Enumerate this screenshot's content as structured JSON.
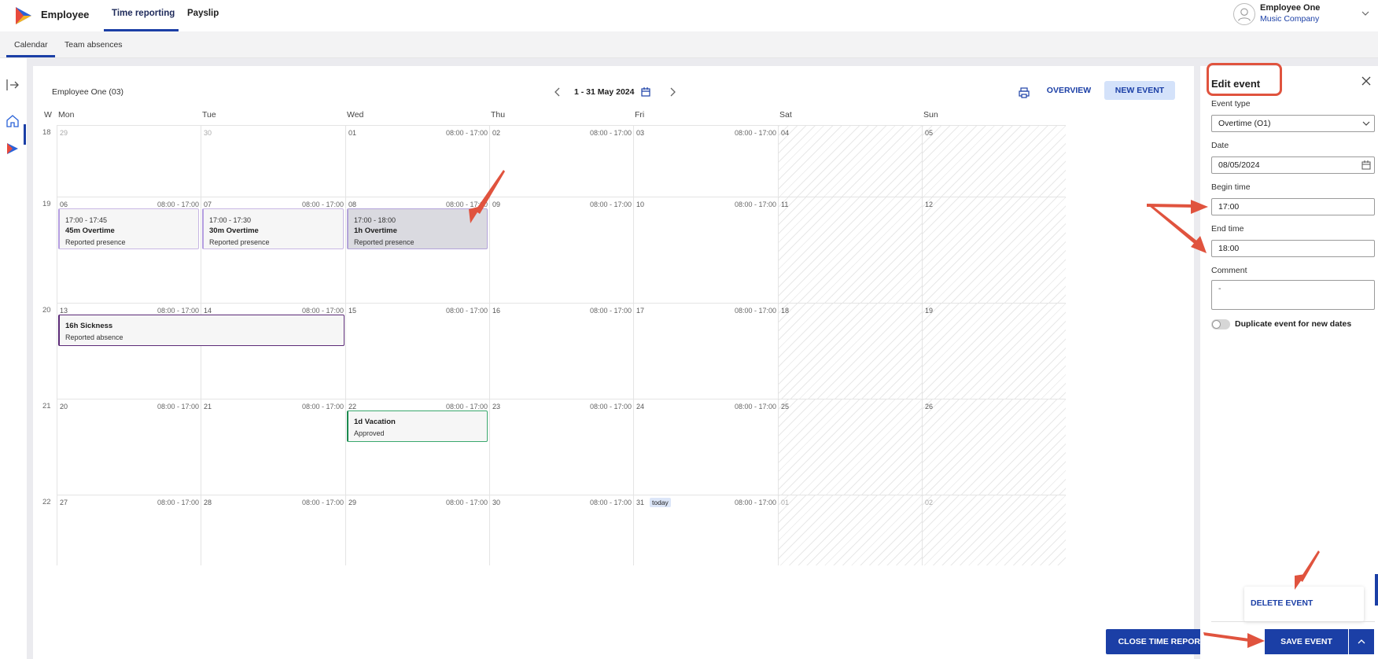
{
  "app": {
    "title": "Employee"
  },
  "main_tabs": [
    {
      "label": "Time reporting",
      "active": true
    },
    {
      "label": "Payslip",
      "active": false
    }
  ],
  "user": {
    "name": "Employee One",
    "company": "Music Company"
  },
  "sub_tabs": [
    {
      "label": "Calendar",
      "active": true
    },
    {
      "label": "Team absences",
      "active": false
    }
  ],
  "calendar": {
    "employee": "Employee One (03)",
    "date_range": "1 - 31 May 2024",
    "overview_label": "OVERVIEW",
    "new_event_label": "NEW EVENT",
    "week_header": "W",
    "day_headers": [
      "Mon",
      "Tue",
      "Wed",
      "Thu",
      "Fri",
      "Sat",
      "Sun"
    ],
    "weeks": [
      {
        "week": "18",
        "days": [
          "29",
          "30",
          "01",
          "02",
          "03",
          "04",
          "05"
        ]
      },
      {
        "week": "19",
        "days": [
          "06",
          "07",
          "08",
          "09",
          "10",
          "11",
          "12"
        ]
      },
      {
        "week": "20",
        "days": [
          "13",
          "14",
          "15",
          "16",
          "17",
          "18",
          "19"
        ]
      },
      {
        "week": "21",
        "days": [
          "20",
          "21",
          "22",
          "23",
          "24",
          "25",
          "26"
        ]
      },
      {
        "week": "22",
        "days": [
          "27",
          "28",
          "29",
          "30",
          "31",
          "01",
          "02"
        ]
      }
    ],
    "work_hours": "08:00 - 17:00",
    "today_label": "today",
    "events": [
      {
        "time": "17:00 - 17:45",
        "title": "45m Overtime",
        "status": "Reported presence"
      },
      {
        "time": "17:00 - 17:30",
        "title": "30m Overtime",
        "status": "Reported presence"
      },
      {
        "time": "17:00 - 18:00",
        "title": "1h Overtime",
        "status": "Reported presence"
      },
      {
        "time": "",
        "title": "16h Sickness",
        "status": "Reported absence"
      },
      {
        "time": "",
        "title": "1d Vacation",
        "status": "Approved"
      }
    ],
    "close_label": "CLOSE TIME REPORT"
  },
  "edit_panel": {
    "title": "Edit event",
    "event_type_label": "Event type",
    "event_type_value": "Overtime (O1)",
    "date_label": "Date",
    "date_value": "08/05/2024",
    "begin_label": "Begin time",
    "begin_value": "17:00",
    "end_label": "End time",
    "end_value": "18:00",
    "comment_label": "Comment",
    "comment_value": "-",
    "duplicate_label": "Duplicate event for new dates",
    "delete_label": "DELETE EVENT",
    "save_label": "SAVE EVENT"
  },
  "colors": {
    "accent": "#1b3fa6",
    "annotation": "#e0533e",
    "sickness": "#5b2a77",
    "vacation": "#1b8a4e"
  }
}
